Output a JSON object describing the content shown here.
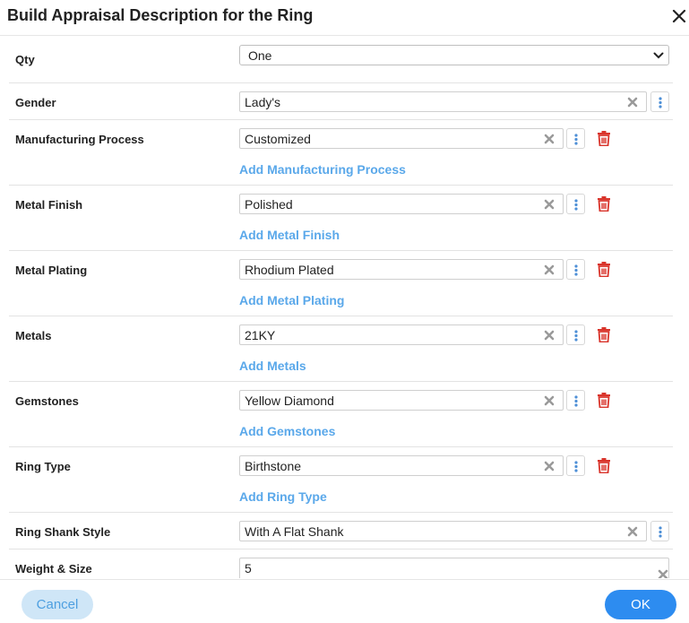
{
  "dialog": {
    "title": "Build Appraisal Description for the Ring"
  },
  "rows": [
    {
      "label": "Qty",
      "value": "One"
    },
    {
      "label": "Gender",
      "value": "Lady's"
    },
    {
      "label": "Manufacturing Process",
      "value": "Customized",
      "add_label": "Add Manufacturing Process"
    },
    {
      "label": "Metal Finish",
      "value": "Polished",
      "add_label": "Add Metal Finish"
    },
    {
      "label": "Metal Plating",
      "value": "Rhodium Plated",
      "add_label": "Add Metal Plating"
    },
    {
      "label": "Metals",
      "value": "21KY",
      "add_label": "Add Metals"
    },
    {
      "label": "Gemstones",
      "value": "Yellow Diamond",
      "add_label": "Add Gemstones"
    },
    {
      "label": "Ring Type",
      "value": "Birthstone",
      "add_label": "Add Ring Type"
    },
    {
      "label": "Ring Shank Style",
      "value": "With A Flat Shank"
    },
    {
      "label": "Weight & Size",
      "value": "5"
    }
  ],
  "footer": {
    "cancel_label": "Cancel",
    "ok_label": "OK"
  },
  "colors": {
    "accent": "#2d8cf0",
    "link": "#5aa8ea",
    "delete": "#d9342b"
  },
  "icons": {
    "close": "close-icon",
    "clear": "clear-x-icon",
    "more": "kebab-menu-icon",
    "delete": "trash-icon",
    "dropdown": "chevron-down-icon"
  }
}
